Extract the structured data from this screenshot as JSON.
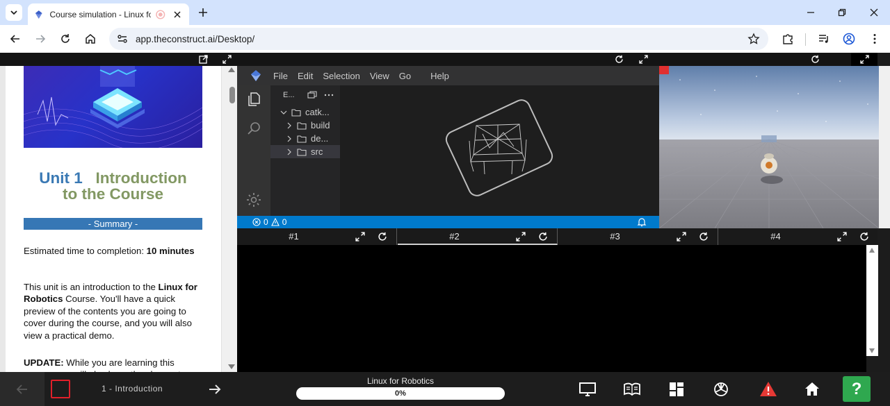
{
  "browser": {
    "tab_title": "Course simulation - Linux fo",
    "url": "app.theconstruct.ai/Desktop/"
  },
  "notebook": {
    "title_unit": "Unit 1",
    "title_rest_line1": "Introduction",
    "title_line2": "to the Course",
    "summary_label": "- Summary -",
    "para1_prefix": "Estimated time to completion: ",
    "para1_bold": "10 minutes",
    "para2_a": "This unit is an introduction to the ",
    "para2_bold": "Linux for Robotics",
    "para2_b": " Course. You'll have a quick preview of the contents you are going to cover during the course, and you will also view a practical demo.",
    "para3_bold": "UPDATE:",
    "para3_text": " While you are learning this course, you will also have the chance to"
  },
  "ide": {
    "menu": [
      "File",
      "Edit",
      "Selection",
      "View",
      "Go",
      "Help"
    ],
    "explorer_label": "E...",
    "tree": {
      "root": "catk...",
      "items": [
        "build",
        "de...",
        "src"
      ]
    },
    "status_errors": "0",
    "status_warnings": "0"
  },
  "terminal_tabs": [
    "#1",
    "#2",
    "#3",
    "#4"
  ],
  "bottom": {
    "unit_label": "1 - Introduction",
    "course_name": "Linux for Robotics",
    "progress_text": "0%",
    "progress_value": 0,
    "help_label": "?"
  },
  "colors": {
    "accent_blue": "#3677b5",
    "title_green": "#829863",
    "status_blue": "#007acc",
    "help_green": "#2fa84f",
    "stop_red": "#e0202a"
  }
}
